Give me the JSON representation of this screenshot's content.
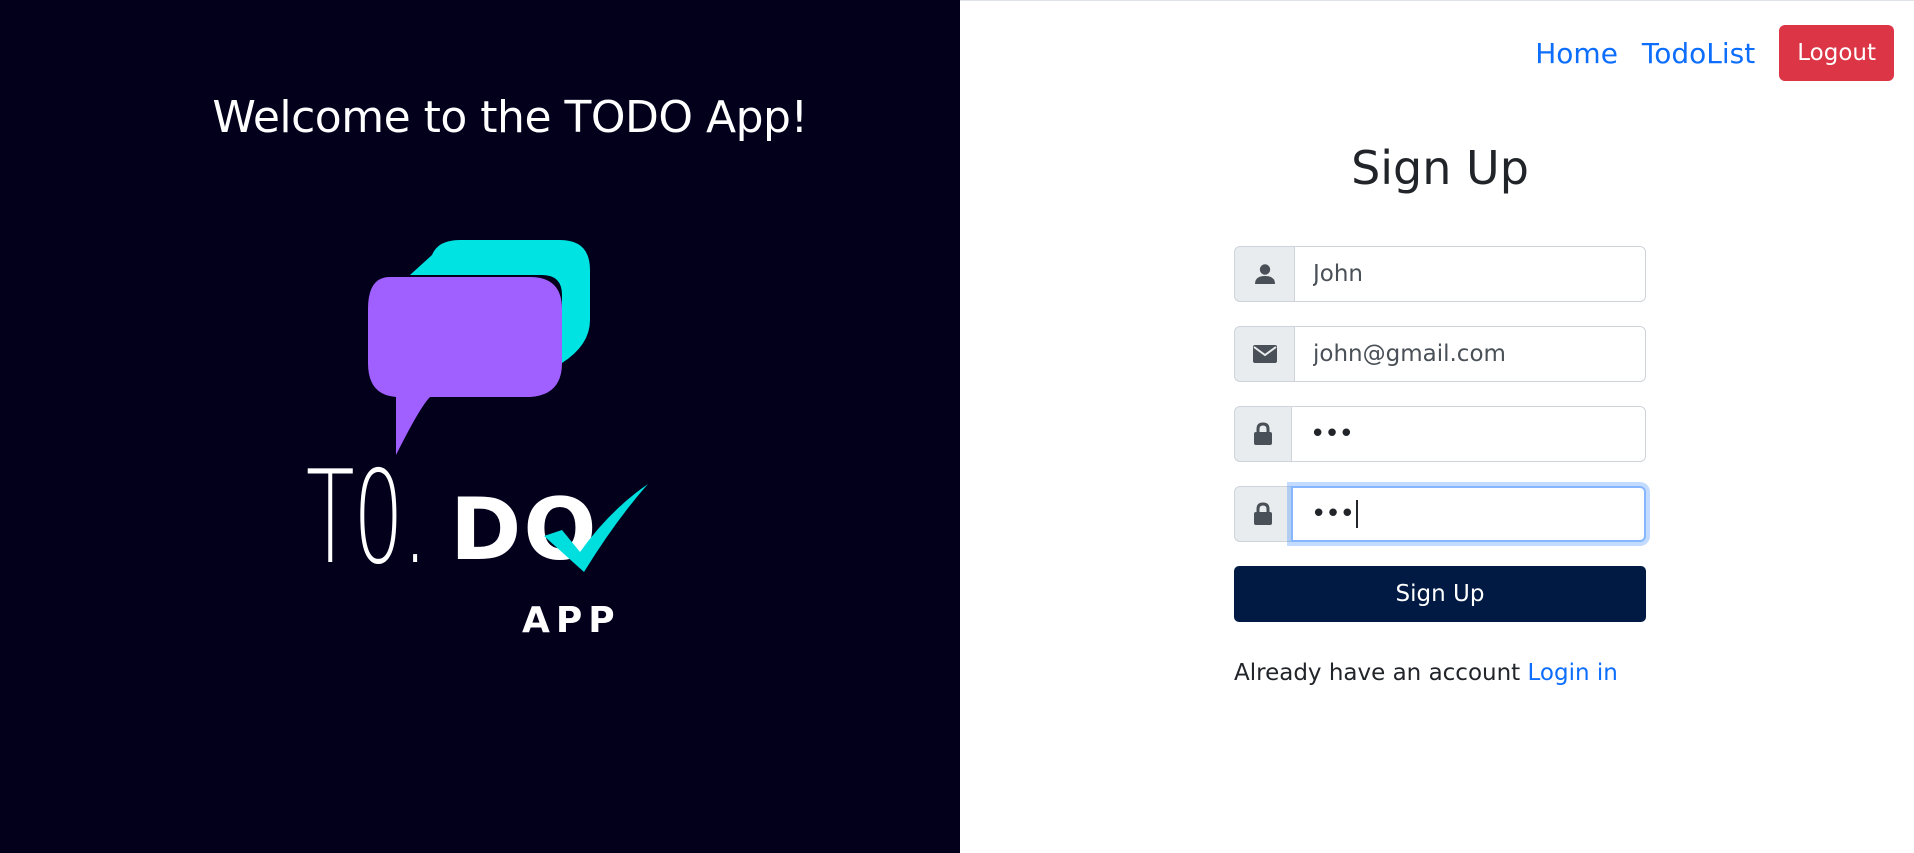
{
  "left": {
    "welcome_title": "Welcome to the TODO App!",
    "logo": {
      "to_text": "T0.",
      "do_text": "DO",
      "app_text": "APP",
      "colors": {
        "bubble_back": "#00e3e3",
        "bubble_front": "#a060ff",
        "check": "#00dede",
        "background": "#03001c"
      }
    }
  },
  "nav": {
    "home": "Home",
    "todolist": "TodoList",
    "logout": "Logout"
  },
  "form": {
    "title": "Sign Up",
    "name": {
      "icon": "user-icon",
      "value": "John"
    },
    "email": {
      "icon": "envelope-icon",
      "value": "john@gmail.com"
    },
    "password": {
      "icon": "lock-icon",
      "display": "•••"
    },
    "confirm_password": {
      "icon": "lock-icon",
      "display": "•••"
    },
    "submit_label": "Sign Up",
    "account_prompt": "Already have an account",
    "login_link": "Login in"
  },
  "colors": {
    "link": "#0d6efd",
    "logout": "#dc3545",
    "submit": "#001a43"
  }
}
